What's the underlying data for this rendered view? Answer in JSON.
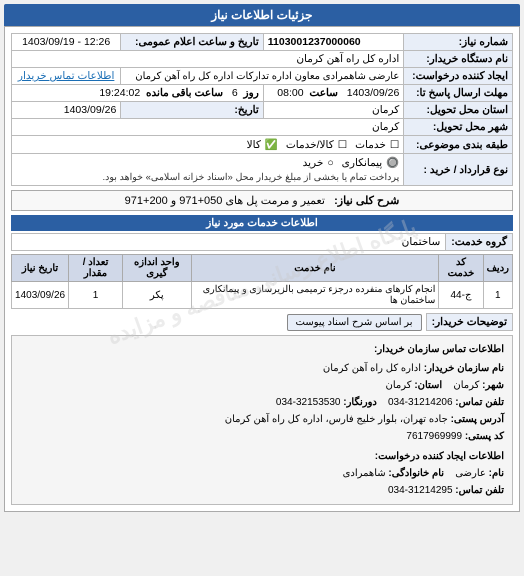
{
  "header": {
    "title": "جزئیات اطلاعات نیاز"
  },
  "info_section": {
    "shomara_niyaz_label": "شماره نیاز:",
    "shomara_niyaz_value": "1103001237000060",
    "name_sazman_label": "نام دستگاه خریدار:",
    "name_sazman_value": "اداره کل راه آهن کرمان",
    "ejad_konande_label": "ایجاد کننده درخواست:",
    "ejad_konande_value": "عارضی  شاهمرادی  معاون اداره تدارکات  اداره کل راه آهن کرمان",
    "ettelaat_tamas_link": "اطلاعات تماس خریدار",
    "mohlat_ersaal_label": "مهلت ارسال پاسخ تا:",
    "mohlat_ersaal_value": "1403/09/26",
    "saaat_label": "ساعت",
    "saaat_value": "08:00",
    "rooz_label": "روز",
    "rooz_value": "6",
    "saaat_baqi_label": "ساعت باقی مانده",
    "saaat_baqi_value": "19:24:02",
    "ostan_tahvil_label": "استان محل تحویل:",
    "ostan_tahvil_value": "کرمان",
    "shahr_mahval_label": "شهر محل تحویل:",
    "shahr_mahval_value": "کرمان",
    "tarikh_label": "تاریخ و ساعت اعلام عمومی:",
    "tarikh_value": "1403/09/19 - 12:26",
    "tarikh_label2": "تاریخ:",
    "tarikh_value2": "1403/09/26",
    "tabaqe_label": "طبقه بندی موضوعی:",
    "tabaqe_kala": "کالا",
    "tabaqe_khadamat": "کالا/خدمات",
    "tabaqe_khadamat_only": "خدمات",
    "tabaqe_selected": "کالا",
    "noe_gharardad_label": "نوع قرارداد / خرید :",
    "noe_kharid": "خرید",
    "noe_paymast": "پیمانکاری",
    "noe_selected": "پیمانکاری",
    "noe_description": "پرداخت تمام یا بخشی از مبلغ خریدار محل «اسناد خزانه اسلامی» خواهد بود."
  },
  "sharh_koli": {
    "label": "شرح کلی نیاز:",
    "value": "تعمیر و مرمت پل های 050+971 و 200+971"
  },
  "ettelaat_khadamat": {
    "title": "اطلاعات خدمات مورد نیاز",
    "group_label": "گروه خدمت:",
    "group_value": "ساختمان",
    "table_headers": [
      "ردیف",
      "کد خدمت",
      "نام خدمت",
      "واحد اندازه گیری",
      "تعداد / مقدار",
      "تاریخ نیاز"
    ],
    "rows": [
      {
        "radif": "1",
        "code": "ج-44",
        "name": "انجام کارهای منفرده درجزء ترمیمی بالزیرسازی و پیمانکاری ساختمان ها",
        "vahed": "پکر",
        "tedad": "1",
        "tarikh": "1403/09/26"
      }
    ]
  },
  "tawzihaat": {
    "label": "توضیحات خریدار:",
    "button": "بر اساس شرح اسناد پیوست"
  },
  "bottom_info": {
    "ettelaat_tamas_title": "اطلاعات تماس سازمان خریدار:",
    "name_sazman_label": "نام سازمان خریدار:",
    "name_sazman_value": "اداره کل راه آهن کرمان",
    "shahr_label": "شهر:",
    "shahr_value": "کرمان",
    "ostan_label": "استان:",
    "ostan_value": "کرمان",
    "telfon_label": "تلفن تماس:",
    "telfon_value": "31214206-034",
    "faks_label": "دورنگار:",
    "faks_value": "32153530-034",
    "adres_label": "آدرس پستی:",
    "adres_value": "جاده تهران، بلوار خلیج فارس، اداره کل راه آهن کرمان",
    "code_posti_label": "کد پستی:",
    "code_posti_value": "7617969999",
    "ettelaat_ejad_title": "اطلاعات ایجاد کننده درخواست:",
    "nam_label": "نام:",
    "nam_value": "عارضی",
    "nam_khanevadegi_label": "نام خانوادگی:",
    "nam_khanevadegi_value": "شاهمرادی",
    "telfon2_label": "تلفن تماس:",
    "telfon2_value": "31214295-034"
  },
  "watermark_text": "پایگاه اطلاع رسانی مناقصه و مزایده"
}
